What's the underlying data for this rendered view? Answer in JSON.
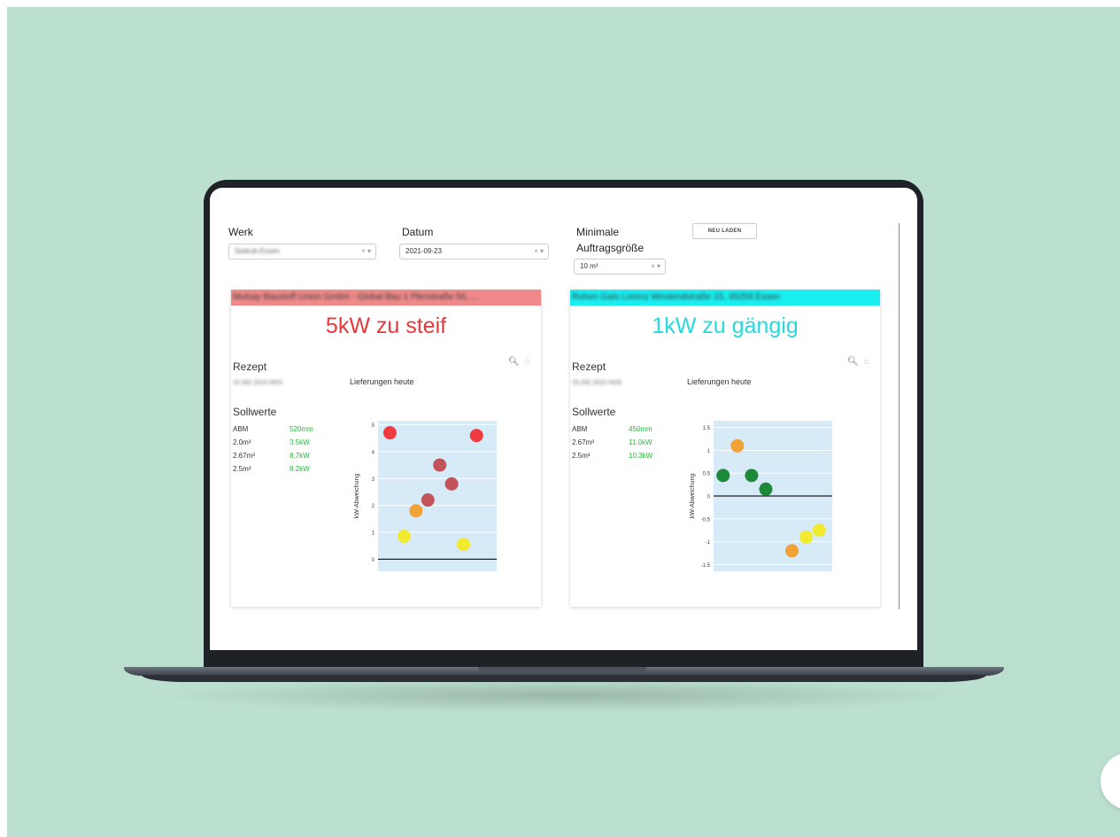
{
  "controls": {
    "werk_label": "Werk",
    "werk_value": "Sedrub-Essen",
    "datum_label": "Datum",
    "datum_value": "2021-09-23",
    "min_label_1": "Minimale",
    "min_label_2": "Auftragsgröße",
    "min_value": "10 m³",
    "clear_glyph": "×",
    "caret_glyph": "▾",
    "reload_label": "NEU LADEN"
  },
  "cards": [
    {
      "header": "Mulsay Baustoff Union GmbH - Global Bau 1 Plenstraße 56, ...",
      "header_color": "#f08a8a",
      "status": "5kW zu steif",
      "status_color": "#e8383c",
      "rezept_label": "Rezept",
      "rezept_value": "15.332.2010 HOS",
      "sollwerte_label": "Sollwerte",
      "rows": [
        {
          "k": "ABM",
          "v": "520mm"
        },
        {
          "k": "2.0m³",
          "v": "3.5kW"
        },
        {
          "k": "2.67m³",
          "v": "8.7kW"
        },
        {
          "k": "2.5m³",
          "v": "8.2kW"
        }
      ],
      "chart_title": "Lieferungen heute",
      "zoom_icon": "zoom-icon",
      "home_icon": "home-icon"
    },
    {
      "header": "Ruhen Gats Lorenz Westendstraße 15, 45259 Essen",
      "header_color": "#19eef0",
      "status": "1kW zu gängig",
      "status_color": "#27d9de",
      "rezept_label": "Rezept",
      "rezept_value": "15.332.2010 HOS",
      "sollwerte_label": "Sollwerte",
      "rows": [
        {
          "k": "ABM",
          "v": "450mm"
        },
        {
          "k": "2.67m³",
          "v": "11.0kW"
        },
        {
          "k": "2.5m³",
          "v": "10.3kW"
        }
      ],
      "chart_title": "Lieferungen heute",
      "zoom_icon": "zoom-icon",
      "home_icon": "home-icon"
    }
  ],
  "chart_data": [
    {
      "type": "scatter",
      "title": "Lieferungen heute",
      "xlabel": "",
      "ylabel": "kW-Abweichung",
      "ylim": [
        -0.45,
        5.15
      ],
      "xlim": [
        0,
        10
      ],
      "yticks": [
        0,
        1,
        2,
        3,
        4,
        5
      ],
      "background": "#d7eaf8",
      "points": [
        {
          "x": 1.0,
          "y": 4.7,
          "color": "#ee3a40"
        },
        {
          "x": 2.2,
          "y": 0.85,
          "color": "#f1ea2f"
        },
        {
          "x": 3.2,
          "y": 1.8,
          "color": "#f0a236"
        },
        {
          "x": 4.2,
          "y": 2.2,
          "color": "#c3535a"
        },
        {
          "x": 5.2,
          "y": 3.5,
          "color": "#c3535a"
        },
        {
          "x": 6.2,
          "y": 2.8,
          "color": "#c3535a"
        },
        {
          "x": 7.2,
          "y": 0.55,
          "color": "#f1ea2f"
        },
        {
          "x": 8.3,
          "y": 4.6,
          "color": "#ee3a40"
        }
      ]
    },
    {
      "type": "scatter",
      "title": "Lieferungen heute",
      "xlabel": "",
      "ylabel": "kW-Abweichung",
      "ylim": [
        -1.65,
        1.65
      ],
      "xlim": [
        0,
        10
      ],
      "yticks": [
        1.5,
        1,
        0.5,
        0,
        -0.5,
        -1,
        -1.5
      ],
      "background": "#d7eaf8",
      "points": [
        {
          "x": 0.8,
          "y": 0.45,
          "color": "#1d8a3a"
        },
        {
          "x": 2.0,
          "y": 1.1,
          "color": "#f0a236"
        },
        {
          "x": 3.2,
          "y": 0.45,
          "color": "#1d8a3a"
        },
        {
          "x": 4.4,
          "y": 0.15,
          "color": "#1d8a3a"
        },
        {
          "x": 6.6,
          "y": -1.2,
          "color": "#f0a236"
        },
        {
          "x": 7.8,
          "y": -0.9,
          "color": "#f1ea2f"
        },
        {
          "x": 8.9,
          "y": -0.75,
          "color": "#f1ea2f"
        }
      ]
    }
  ]
}
